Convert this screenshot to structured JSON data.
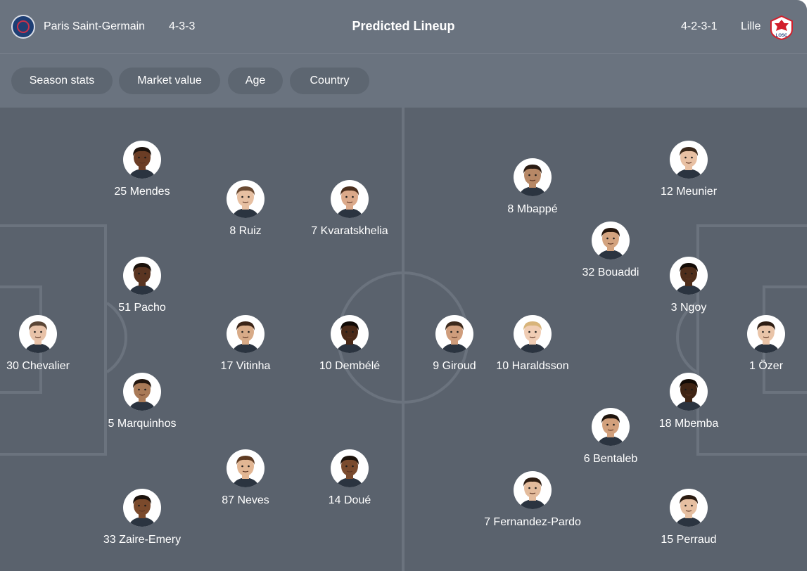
{
  "header": {
    "home_team": "Paris Saint-Germain",
    "home_formation": "4-3-3",
    "title": "Predicted Lineup",
    "away_formation": "4-2-3-1",
    "away_team": "Lille",
    "away_crest_text": "LOSC"
  },
  "filters": [
    "Season stats",
    "Market value",
    "Age",
    "Country"
  ],
  "colors": {
    "panel": "#6a737f",
    "pitch": "#5a626d",
    "chip": "#5d6671",
    "lille_red": "#d21e2b"
  },
  "players": [
    {
      "key": "chevalier",
      "number": "30",
      "name": "Chevalier",
      "skin": "#e8c2a8",
      "hair": "#5b4636"
    },
    {
      "key": "mendes",
      "number": "25",
      "name": "Mendes",
      "skin": "#6b3d25",
      "hair": "#1c120c"
    },
    {
      "key": "pacho",
      "number": "51",
      "name": "Pacho",
      "skin": "#5a3521",
      "hair": "#1a110b"
    },
    {
      "key": "marquinhos",
      "number": "5",
      "name": "Marquinhos",
      "skin": "#a97a57",
      "hair": "#23170f"
    },
    {
      "key": "zaire-emery",
      "number": "33",
      "name": "Zaire-Emery",
      "skin": "#7b4a2c",
      "hair": "#1b120c"
    },
    {
      "key": "ruiz",
      "number": "8",
      "name": "Ruiz",
      "skin": "#e7c0a2",
      "hair": "#6a4a32"
    },
    {
      "key": "vitinha",
      "number": "17",
      "name": "Vitinha",
      "skin": "#d8ab88",
      "hair": "#3b2518"
    },
    {
      "key": "neves",
      "number": "87",
      "name": "Neves",
      "skin": "#e2b693",
      "hair": "#5e3b22"
    },
    {
      "key": "kvaratskhelia",
      "number": "7",
      "name": "Kvaratskhelia",
      "skin": "#dba98a",
      "hair": "#4a2e1d"
    },
    {
      "key": "dembele",
      "number": "10",
      "name": "Dembélé",
      "skin": "#4a2a18",
      "hair": "#120b07"
    },
    {
      "key": "doue",
      "number": "14",
      "name": "Doué",
      "skin": "#7a4b2e",
      "hair": "#1c120b"
    },
    {
      "key": "giroud",
      "number": "9",
      "name": "Giroud",
      "skin": "#cf9d7c",
      "hair": "#3d2a1d"
    },
    {
      "key": "mbappe",
      "number": "8",
      "name": "Mbappé",
      "skin": "#b78866",
      "hair": "#2a1b12"
    },
    {
      "key": "haraldsson",
      "number": "10",
      "name": "Haraldsson",
      "skin": "#f0cdb4",
      "hair": "#d8b47a"
    },
    {
      "key": "fernandez-pardo",
      "number": "7",
      "name": "Fernandez-Pardo",
      "skin": "#e3bb9c",
      "hair": "#2e1d12"
    },
    {
      "key": "bouaddi",
      "number": "32",
      "name": "Bouaddi",
      "skin": "#d3a37f",
      "hair": "#24160d"
    },
    {
      "key": "bentaleb",
      "number": "6",
      "name": "Bentaleb",
      "skin": "#d2a07c",
      "hair": "#1f140d"
    },
    {
      "key": "meunier",
      "number": "12",
      "name": "Meunier",
      "skin": "#e8c0a3",
      "hair": "#3a281b"
    },
    {
      "key": "ngoy",
      "number": "3",
      "name": "Ngoy",
      "skin": "#4f2e1b",
      "hair": "#150d08"
    },
    {
      "key": "mbemba",
      "number": "18",
      "name": "Mbemba",
      "skin": "#3f2414",
      "hair": "#120b06"
    },
    {
      "key": "perraud",
      "number": "15",
      "name": "Perraud",
      "skin": "#e6bfa1",
      "hair": "#2a1b11"
    },
    {
      "key": "ozer",
      "number": "1",
      "name": "Özer",
      "skin": "#e9c4a8",
      "hair": "#2d1d13"
    }
  ]
}
